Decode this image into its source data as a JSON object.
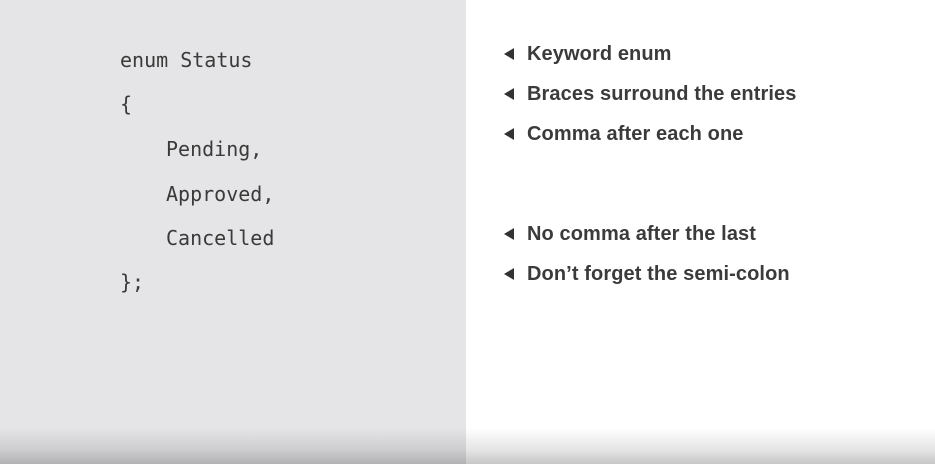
{
  "code": {
    "lines": [
      "enum Status",
      "{",
      "Pending,",
      "Approved,",
      "Cancelled",
      "};"
    ]
  },
  "notes": [
    "Keyword enum",
    "Braces surround the entries",
    "Comma after each one",
    "No comma after the last",
    "Don’t forget the semi-colon"
  ],
  "colors": {
    "code_background": "#e5e4e6",
    "notes_background": "#ffffff",
    "text": "#3b3b3b"
  },
  "icons": {
    "note_marker": "left-triangle-icon"
  }
}
